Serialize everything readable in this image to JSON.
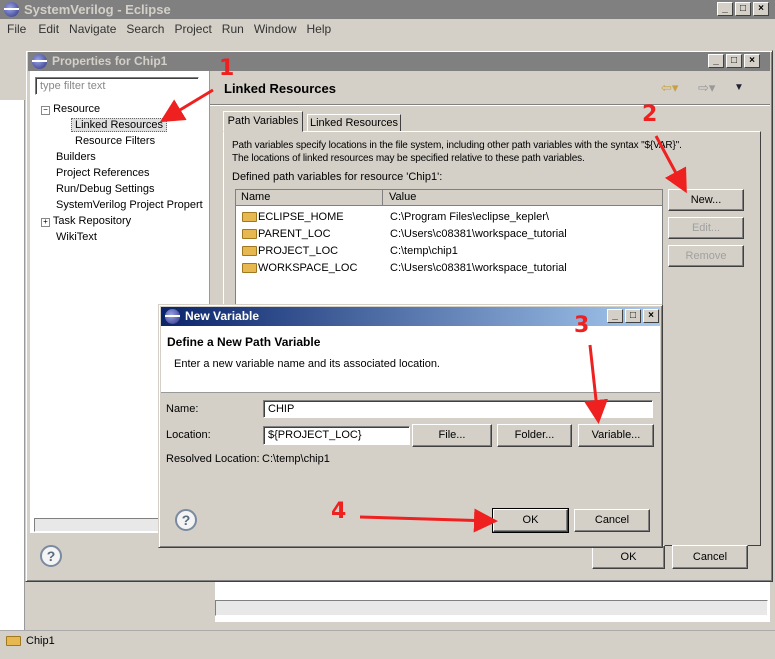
{
  "app": {
    "title": "SystemVerilog - Eclipse",
    "menu": [
      "File",
      "Edit",
      "Navigate",
      "Search",
      "Project",
      "Run",
      "Window",
      "Help"
    ],
    "status": "Chip1"
  },
  "properties": {
    "title": "Properties for Chip1",
    "filter_placeholder": "type filter text",
    "tree": [
      "Resource",
      "Linked Resources",
      "Resource Filters",
      "Builders",
      "Project References",
      "Run/Debug Settings",
      "SystemVerilog Project Propert",
      "Task Repository",
      "WikiText"
    ],
    "heading": "Linked Resources",
    "tabs": [
      "Path Variables",
      "Linked Resources"
    ],
    "desc1": "Path variables specify locations in the file system, including other path variables with the syntax \"${VAR}\".",
    "desc2": "The locations of linked resources may be specified relative to these path variables.",
    "defined": "Defined path variables for resource 'Chip1':",
    "columns": [
      "Name",
      "Value"
    ],
    "rows": [
      {
        "name": "ECLIPSE_HOME",
        "value": "C:\\Program Files\\eclipse_kepler\\"
      },
      {
        "name": "PARENT_LOC",
        "value": "C:\\Users\\c08381\\workspace_tutorial"
      },
      {
        "name": "PROJECT_LOC",
        "value": "C:\\temp\\chip1"
      },
      {
        "name": "WORKSPACE_LOC",
        "value": "C:\\Users\\c08381\\workspace_tutorial"
      }
    ],
    "new": "New...",
    "edit": "Edit...",
    "remove": "Remove",
    "ok": "OK",
    "cancel": "Cancel"
  },
  "newvar": {
    "title": "New Variable",
    "heading": "Define a New Path Variable",
    "desc": "Enter a new variable name and its associated location.",
    "name_label": "Name:",
    "name_value": "CHIP",
    "location_label": "Location:",
    "location_value": "${PROJECT_LOC}",
    "file": "File...",
    "folder": "Folder...",
    "variable": "Variable...",
    "resolved_label": "Resolved Location:",
    "resolved_value": "C:\\temp\\chip1",
    "ok": "OK",
    "cancel": "Cancel"
  },
  "annotations": [
    "1",
    "2",
    "3",
    "4"
  ],
  "colors": {
    "annotation": "#ee2020",
    "active_title": "#0a246a"
  }
}
